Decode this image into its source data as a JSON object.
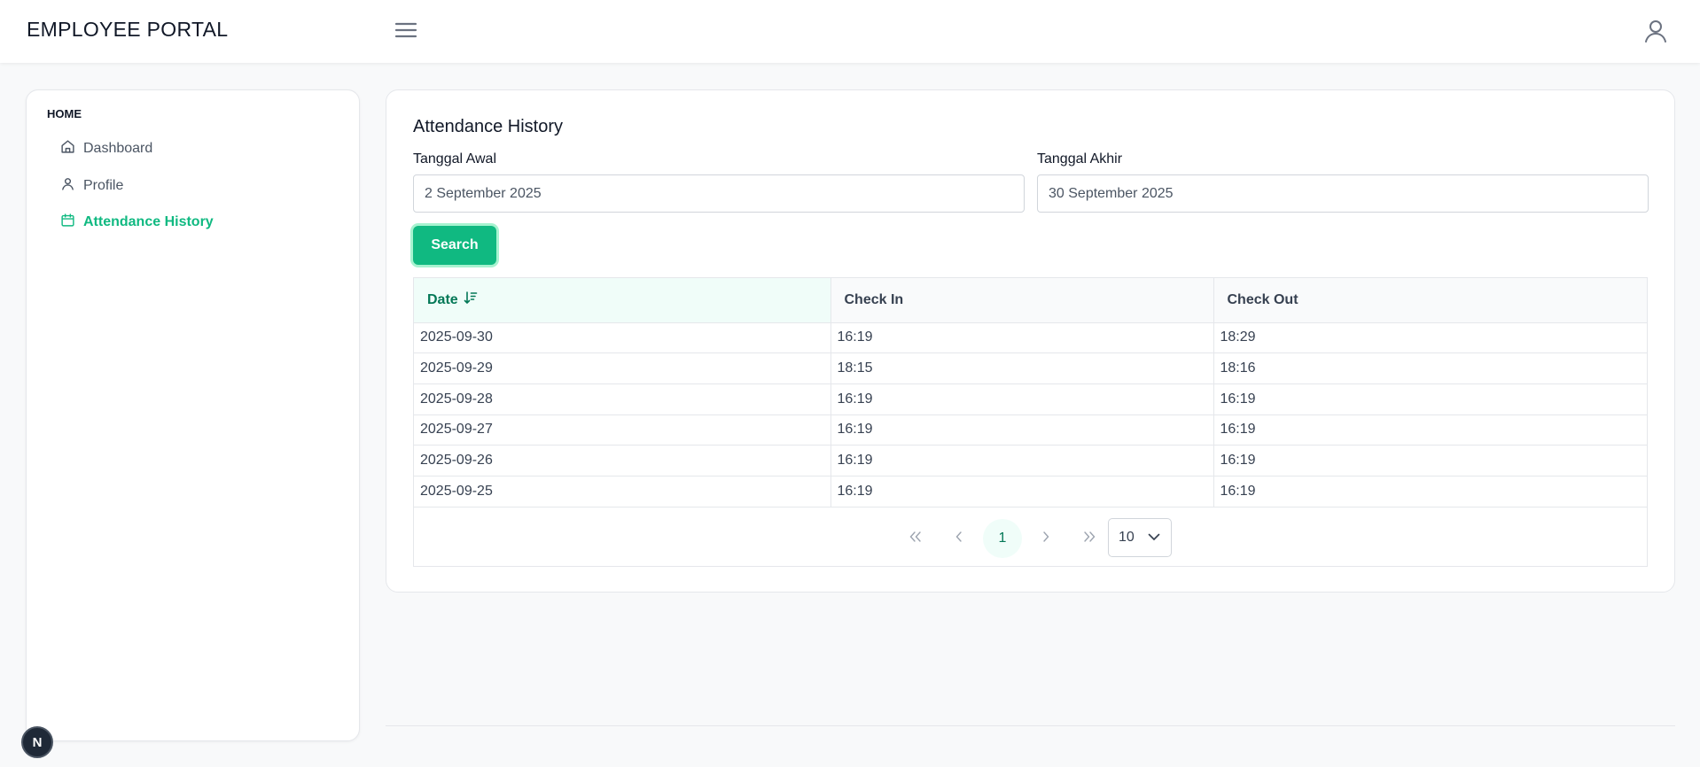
{
  "header": {
    "brand": "EMPLOYEE PORTAL",
    "menu_icon": "hamburger-menu-icon",
    "user_icon": "user-icon"
  },
  "sidebar": {
    "heading": "HOME",
    "items": [
      {
        "label": "Dashboard",
        "icon": "home-icon",
        "active": false
      },
      {
        "label": "Profile",
        "icon": "user-icon",
        "active": false
      },
      {
        "label": "Attendance History",
        "icon": "calendar-icon",
        "active": true
      }
    ]
  },
  "main": {
    "title": "Attendance History",
    "start_date": {
      "label": "Tanggal Awal",
      "value": "2 September 2025"
    },
    "end_date": {
      "label": "Tanggal Akhir",
      "value": "30 September 2025"
    },
    "search_label": "Search",
    "table": {
      "columns": [
        "Date",
        "Check In",
        "Check Out"
      ],
      "sorted_column": "Date",
      "rows": [
        [
          "2025-09-30",
          "16:19",
          "18:29"
        ],
        [
          "2025-09-29",
          "18:15",
          "18:16"
        ],
        [
          "2025-09-28",
          "16:19",
          "16:19"
        ],
        [
          "2025-09-27",
          "16:19",
          "16:19"
        ],
        [
          "2025-09-26",
          "16:19",
          "16:19"
        ],
        [
          "2025-09-25",
          "16:19",
          "16:19"
        ]
      ]
    },
    "pagination": {
      "current_page": "1",
      "page_size": "10"
    }
  },
  "colors": {
    "accent": "#10b981",
    "accent_dark": "#047857",
    "accent_light": "#f0fdf9"
  },
  "fab_label": "N"
}
